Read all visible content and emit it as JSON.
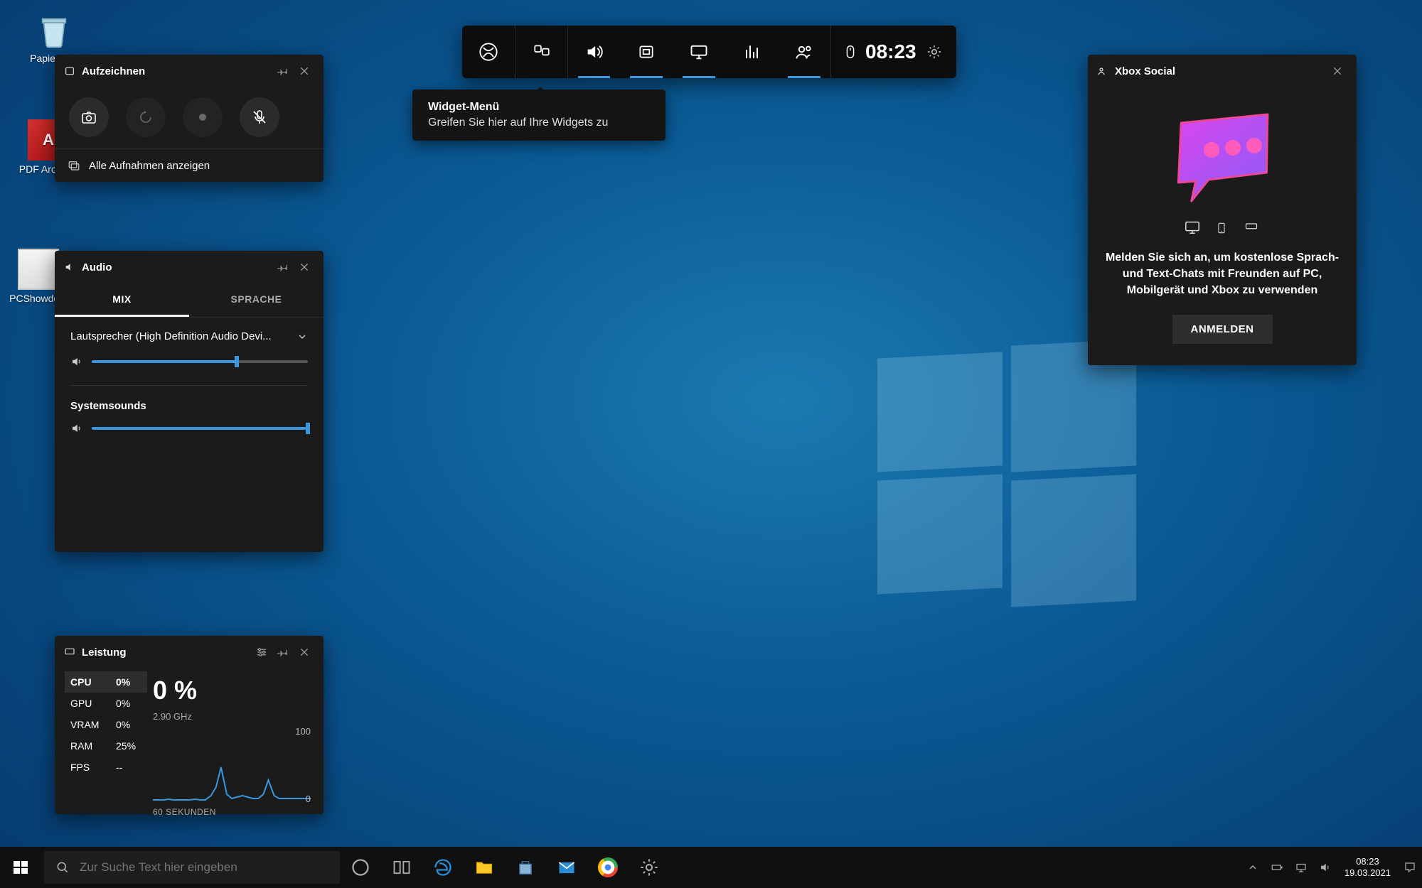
{
  "desktop": {
    "recycle": "Papierkorb",
    "pdf": "PDF Archiver",
    "pcshow": "PCShowde..."
  },
  "toolbar": {
    "clock": "08:23"
  },
  "tooltip": {
    "title": "Widget-Menü",
    "body": "Greifen Sie hier auf Ihre Widgets zu"
  },
  "capture": {
    "title": "Aufzeichnen",
    "show_all": "Alle Aufnahmen anzeigen"
  },
  "audio": {
    "title": "Audio",
    "tab_mix": "MIX",
    "tab_voice": "SPRACHE",
    "device": "Lautsprecher (High Definition Audio Devi...",
    "system_sounds": "Systemsounds",
    "device_level": 67,
    "system_level": 100
  },
  "perf": {
    "title": "Leistung",
    "rows": [
      {
        "lab": "CPU",
        "val": "0%"
      },
      {
        "lab": "GPU",
        "val": "0%"
      },
      {
        "lab": "VRAM",
        "val": "0%"
      },
      {
        "lab": "RAM",
        "val": "25%"
      },
      {
        "lab": "FPS",
        "val": "--"
      }
    ],
    "big": "0 %",
    "ghz": "2.90 GHz",
    "ymax": "100",
    "ymin": "0",
    "xlabel": "60 SEKUNDEN"
  },
  "social": {
    "title": "Xbox Social",
    "text": "Melden Sie sich an, um kostenlose Sprach- und Text-Chats mit Freunden auf PC, Mobilgerät und Xbox zu verwenden",
    "signin": "ANMELDEN"
  },
  "taskbar": {
    "search_placeholder": "Zur Suche Text hier eingeben",
    "time": "08:23",
    "date": "19.03.2021"
  },
  "chart_data": {
    "type": "line",
    "title": "CPU",
    "xlabel": "60 SEKUNDEN",
    "ylabel": "",
    "ylim": [
      0,
      100
    ],
    "x_seconds_ago": [
      60,
      58,
      56,
      54,
      52,
      50,
      48,
      46,
      44,
      42,
      40,
      38,
      36,
      34,
      32,
      30,
      28,
      26,
      24,
      22,
      20,
      18,
      16,
      14,
      12,
      10,
      8,
      6,
      4,
      2,
      0
    ],
    "values": [
      2,
      2,
      2,
      3,
      2,
      2,
      2,
      2,
      3,
      2,
      2,
      8,
      20,
      48,
      10,
      4,
      6,
      8,
      6,
      4,
      4,
      10,
      30,
      8,
      4,
      4,
      4,
      4,
      4,
      4,
      4
    ]
  }
}
